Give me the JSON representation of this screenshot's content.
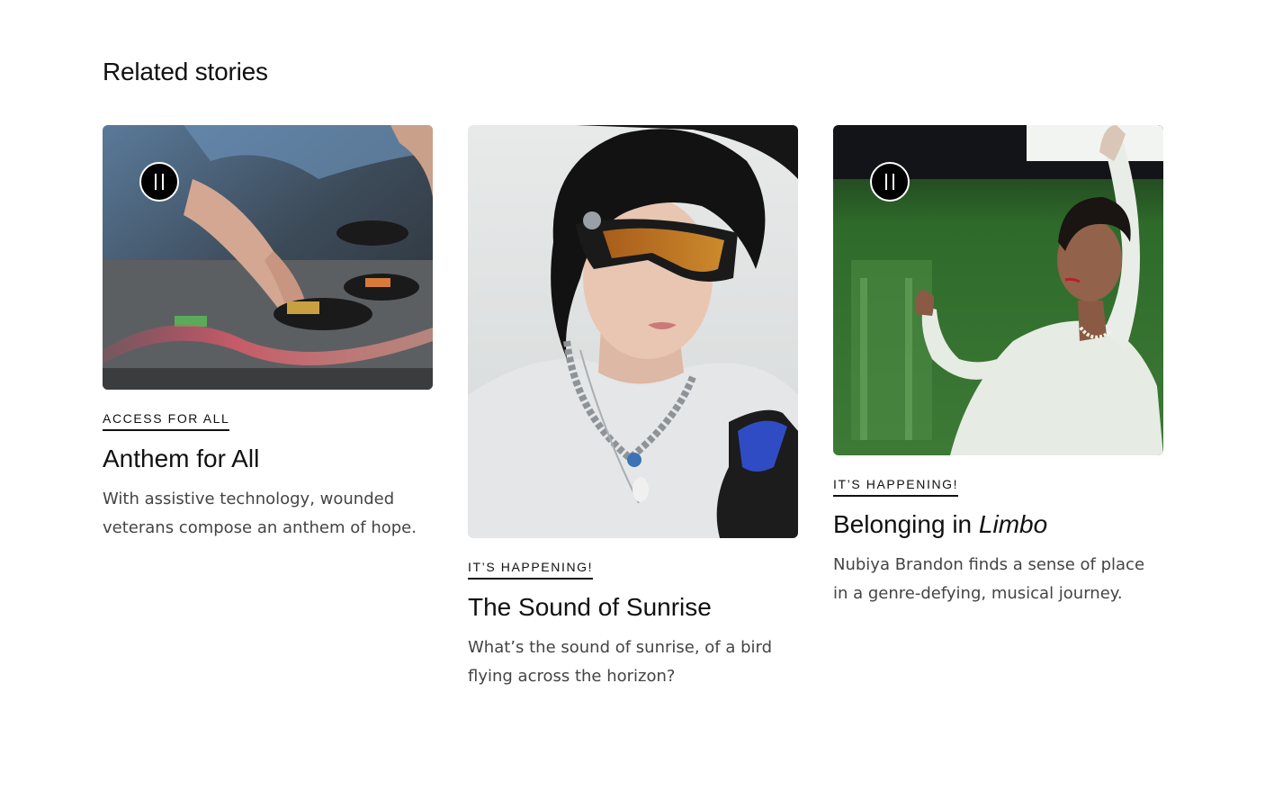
{
  "section": {
    "title": "Related stories"
  },
  "cards": [
    {
      "eyebrow": "ACCESS FOR ALL",
      "headline": "Anthem for All",
      "headline_italic": "",
      "description": "With assistive technology, wounded veterans compose an anthem of hope.",
      "has_pause": true,
      "pause_icon": "pause-icon"
    },
    {
      "eyebrow": "IT’S HAPPENING!",
      "headline": "The Sound of Sunrise",
      "headline_italic": "",
      "description": "What’s the sound of sunrise, of a bird flying across the horizon?",
      "has_pause": false
    },
    {
      "eyebrow": "IT’S HAPPENING!",
      "headline": "Belonging in ",
      "headline_italic": "Limbo",
      "description": "Nubiya Brandon finds a sense of place in a genre-defying, musical journey.",
      "has_pause": true,
      "pause_icon": "pause-icon"
    }
  ],
  "colors": {
    "text": "#111111",
    "body_text": "#444444",
    "background": "#ffffff"
  }
}
